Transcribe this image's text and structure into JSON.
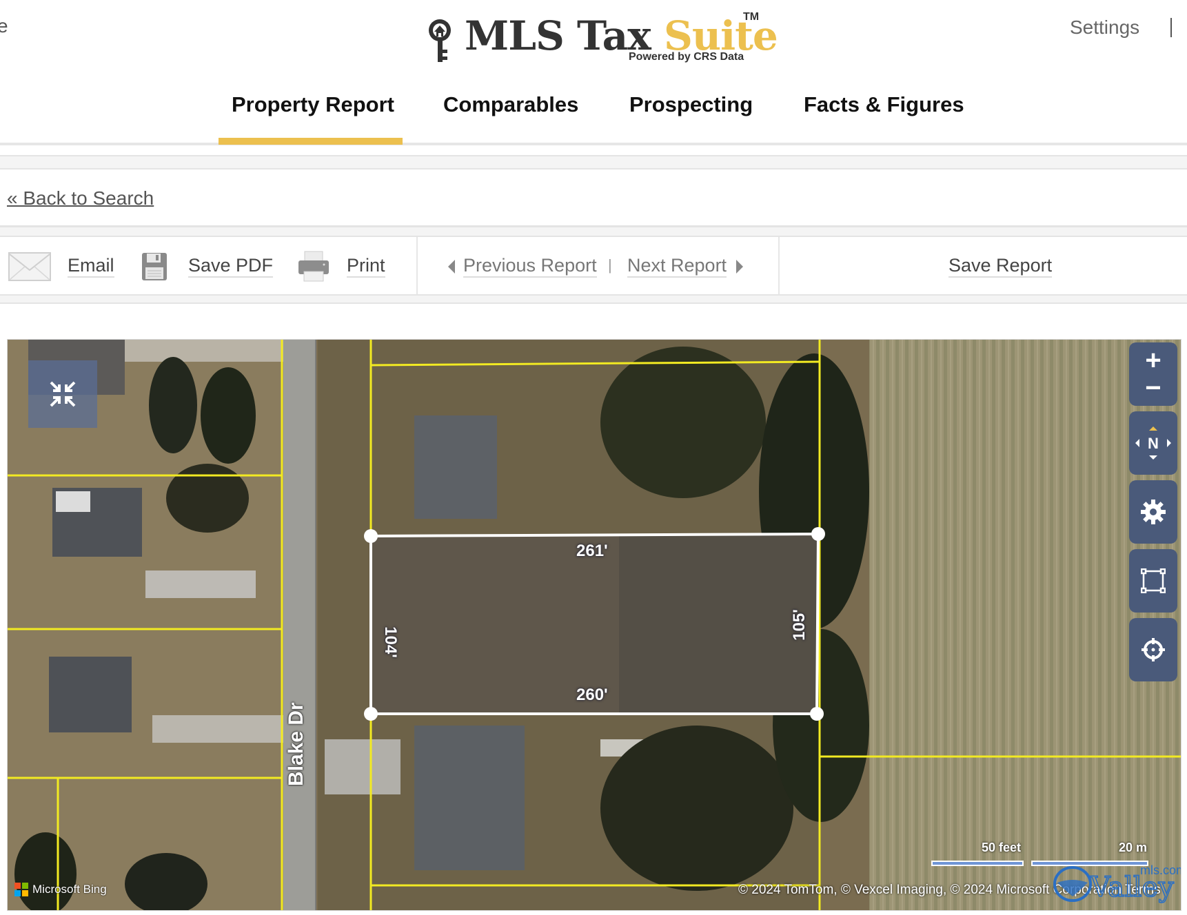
{
  "header": {
    "left_cut_text": "e",
    "logo": {
      "title_part1": "MLS Tax ",
      "title_part2": "Suite",
      "trademark": "TM",
      "powered_by": "Powered by CRS Data",
      "accent_color": "#ecc04f"
    },
    "settings_label": "Settings"
  },
  "tabs": [
    {
      "label": "Property Report",
      "active": true
    },
    {
      "label": "Comparables",
      "active": false
    },
    {
      "label": "Prospecting",
      "active": false
    },
    {
      "label": "Facts & Figures",
      "active": false
    }
  ],
  "back_link": "« Back to Search",
  "toolbar": {
    "email": {
      "label": "Email",
      "icon": "envelope-icon"
    },
    "save_pdf": {
      "label": "Save PDF",
      "icon": "floppy-disk-icon"
    },
    "print": {
      "label": "Print",
      "icon": "printer-icon"
    },
    "previous_report": "Previous Report",
    "separator": "|",
    "next_report": "Next Report",
    "save_report": "Save Report"
  },
  "map": {
    "parcel_dimensions": {
      "top": "261'",
      "bottom": "260'",
      "left": "104'",
      "right": "105'"
    },
    "street_label": "Blake Dr",
    "controls": {
      "zoom_in": "+",
      "zoom_out": "−",
      "compass": "N"
    },
    "scale": {
      "imperial": "50 feet",
      "metric": "20 m"
    },
    "copyright": "© 2024 TomTom, © Vexcel Imaging, © 2024 Microsoft Corporation Terms",
    "provider": "Microsoft Bing",
    "watermark": {
      "main": "Valley",
      "suffix": "mls.com"
    }
  }
}
